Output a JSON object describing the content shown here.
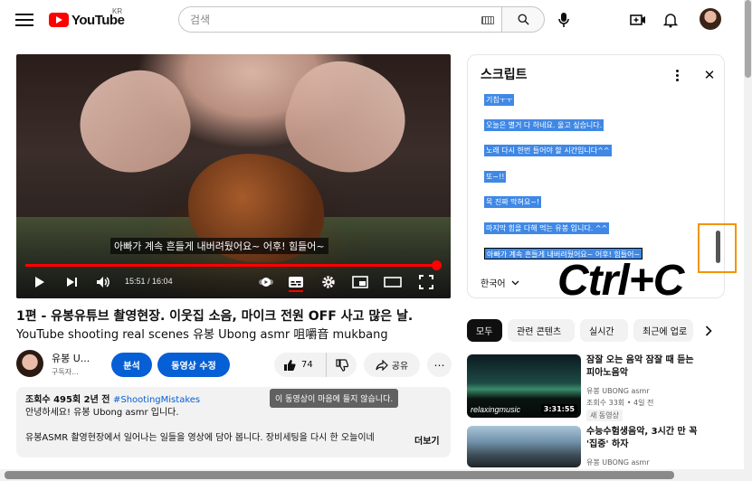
{
  "header": {
    "logo_text": "YouTube",
    "region": "KR",
    "search_placeholder": "검색",
    "icons": [
      "menu-icon",
      "keyboard-icon",
      "search-icon",
      "mic-icon",
      "create-icon",
      "bell-icon"
    ]
  },
  "player": {
    "caption": "아빠가 계속 흔들게 내버려뒀어요~ 어후! 힘들어~",
    "current_time": "15:51",
    "duration": "16:04",
    "progress": 0.986
  },
  "video": {
    "title_line1": "1편 - 유봉유튜브 촬영현장. 이웃집 소음, 마이크 전원 OFF 사고 많은 날.",
    "title_line2": "YouTube shooting real scenes 유봉 Ubong asmr 咀嚼音 mukbang",
    "channel_name": "유봉 U...",
    "channel_subs": "구독자...",
    "analytics_button": "분석",
    "edit_button": "동영상 수정",
    "like_count": "74",
    "share_label": "공유",
    "description": {
      "views": "조회수 495회",
      "age": "2년 전",
      "hashtag": "#ShootingMistakes",
      "line1": "안녕하세요! 유봉 Ubong asmr 입니다.",
      "line2": "유봉ASMR 촬영현장에서 일어나는 일들을 영상에 담아 봅니다. 장비세팅을 다시 한 오늘이네",
      "more": "더보기"
    },
    "tooltip": "이 동영상이 마음에 들지 않습니다."
  },
  "transcript": {
    "title": "스크립트",
    "segments": [
      "기침ㅜㅜ",
      "오늘은 별거 다 하네요. 울고 싶습니다.",
      "노래 다시 한번 들어야 할 시간입니다^^",
      "또~!!",
      "목 진짜 막혀요~!",
      "마지막 힘을 다해 먹는 유봉 입니다. ^^",
      "아빠가 계속 흔들게 내버려뒀어요~ 어후! 힘들어~"
    ],
    "language": "한국어",
    "shortcut_overlay": "Ctrl+C"
  },
  "chips": [
    "모두",
    "관련 콘텐츠",
    "실시간",
    "최근에 업로"
  ],
  "recommendations": [
    {
      "title_line1": "잠잘 오는 음악 잠잘 때 듣는",
      "title_line2": "피아노음악",
      "channel": "유봉 UBONG asmr",
      "views": "조회수 33회",
      "age": "4일 전",
      "badge": "새 동영상",
      "duration": "3:31:55",
      "watermark": "relaxingmusic"
    },
    {
      "title_line1": "수능수험생음악, 3시간 만 꼭",
      "title_line2": "'집중' 하자",
      "channel": "유봉 UBONG asmr"
    }
  ]
}
